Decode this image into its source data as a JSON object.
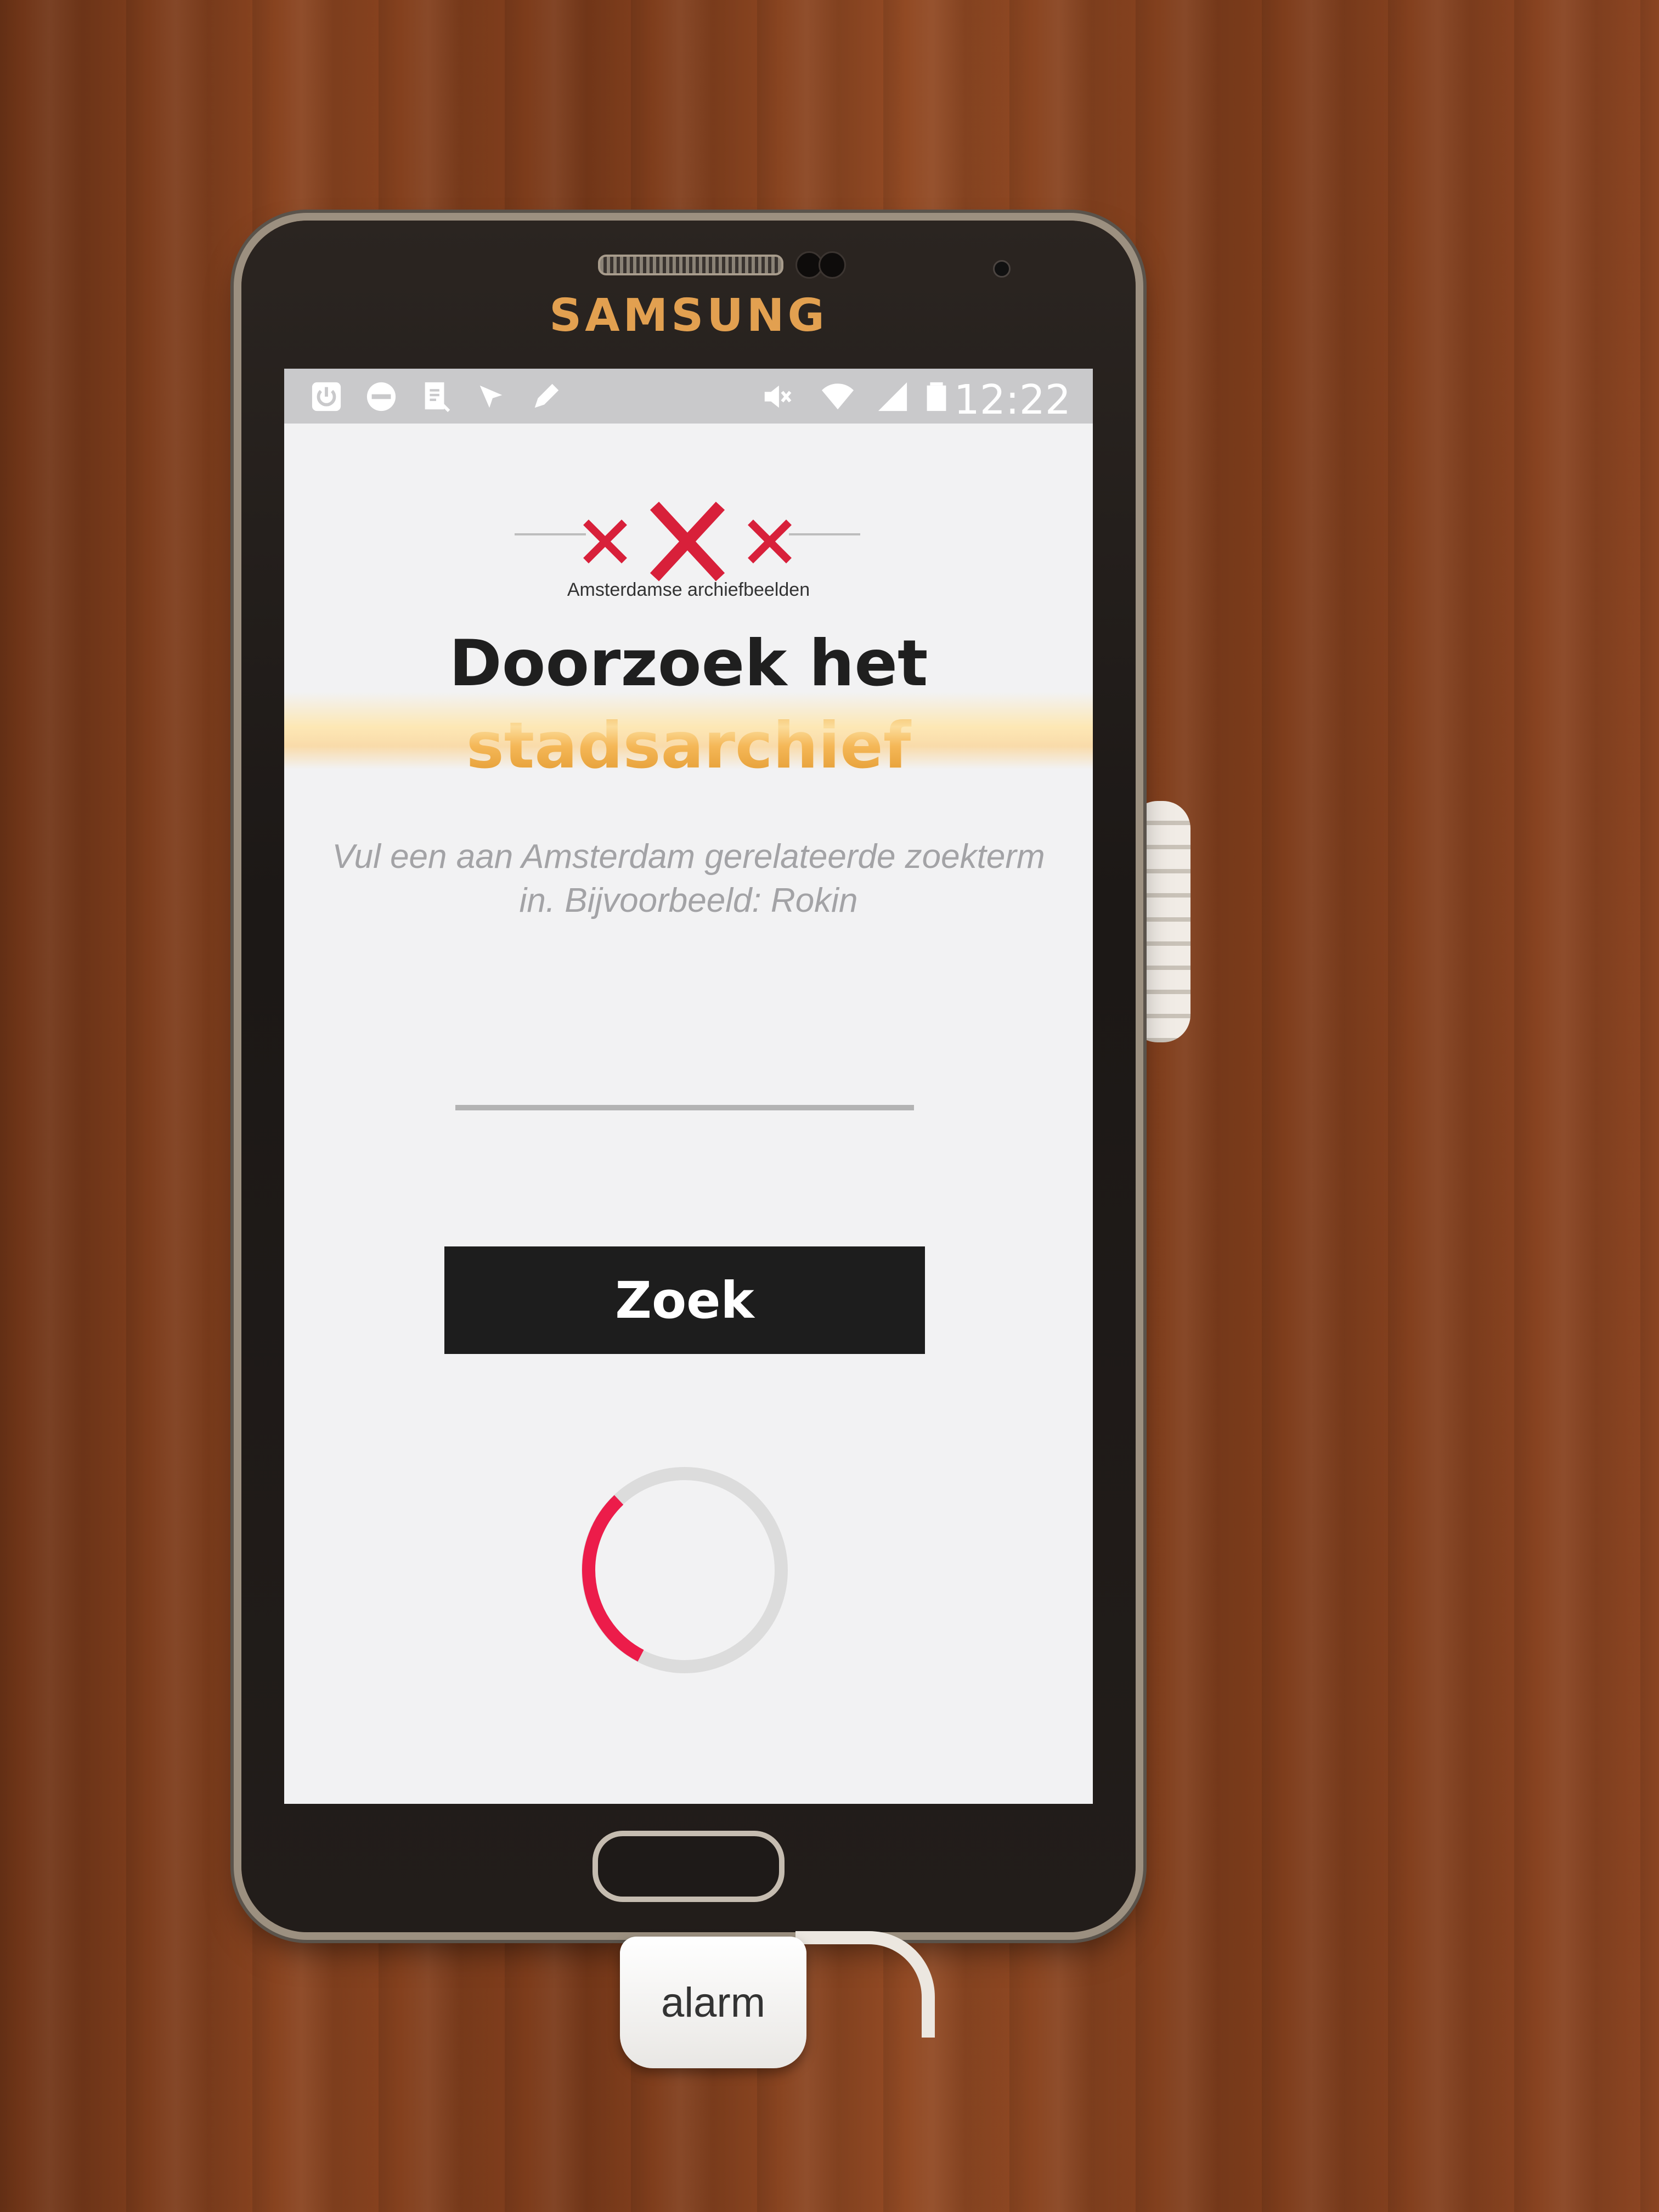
{
  "device": {
    "brand": "SAMSUNG",
    "alarm_tag": "alarm"
  },
  "status_bar": {
    "time": "12:22",
    "icons": [
      "power-icon",
      "minus-circle-icon",
      "document-edit-icon",
      "download-icon",
      "pencil-icon",
      "mute-icon",
      "wifi-icon",
      "signal-icon",
      "battery-icon"
    ]
  },
  "app": {
    "logo_caption": "Amsterdamse archiefbeelden",
    "title_line1": "Doorzoek het",
    "title_line2": "stadsarchief",
    "hint": "Vul een aan Amsterdam gerelateerde zoekterm in. Bijvoorbeeld: Rokin",
    "search": {
      "value": "",
      "placeholder": ""
    },
    "search_button_label": "Zoek",
    "loading": true
  },
  "colors": {
    "accent_red": "#d8203a",
    "spinner_red": "#ec1c4a",
    "title_accent": "#e8a33c",
    "button_bg": "#1d1d1d",
    "screen_bg": "#f2f2f3"
  }
}
